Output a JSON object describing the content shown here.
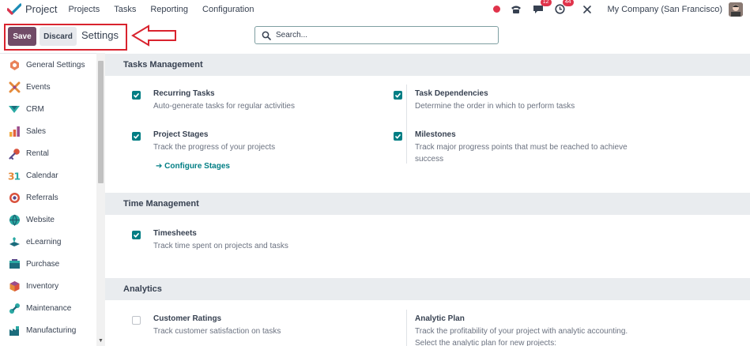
{
  "navbar": {
    "app_name": "Project",
    "menu": [
      "Projects",
      "Tasks",
      "Reporting",
      "Configuration"
    ],
    "messages_count": "12",
    "activities_count": "44",
    "company": "My Company (San Francisco)"
  },
  "control_panel": {
    "save_label": "Save",
    "discard_label": "Discard",
    "title": "Settings",
    "search_placeholder": "Search..."
  },
  "sidebar": {
    "items": [
      {
        "label": "General Settings",
        "icon": "general-settings-icon"
      },
      {
        "label": "Events",
        "icon": "events-icon"
      },
      {
        "label": "CRM",
        "icon": "crm-icon"
      },
      {
        "label": "Sales",
        "icon": "sales-icon"
      },
      {
        "label": "Rental",
        "icon": "rental-icon"
      },
      {
        "label": "Calendar",
        "icon": "calendar-icon"
      },
      {
        "label": "Referrals",
        "icon": "referrals-icon"
      },
      {
        "label": "Website",
        "icon": "website-icon"
      },
      {
        "label": "eLearning",
        "icon": "elearning-icon"
      },
      {
        "label": "Purchase",
        "icon": "purchase-icon"
      },
      {
        "label": "Inventory",
        "icon": "inventory-icon"
      },
      {
        "label": "Maintenance",
        "icon": "maintenance-icon"
      },
      {
        "label": "Manufacturing",
        "icon": "manufacturing-icon"
      }
    ]
  },
  "sections": {
    "tasks": {
      "title": "Tasks Management",
      "recurring": {
        "title": "Recurring Tasks",
        "desc": "Auto-generate tasks for regular activities",
        "checked": true
      },
      "dependencies": {
        "title": "Task Dependencies",
        "desc": "Determine the order in which to perform tasks",
        "checked": true
      },
      "stages": {
        "title": "Project Stages",
        "desc": "Track the progress of your projects",
        "link": "Configure Stages",
        "checked": true
      },
      "milestones": {
        "title": "Milestones",
        "desc": "Track major progress points that must be reached to achieve success",
        "checked": true
      }
    },
    "time": {
      "title": "Time Management",
      "timesheets": {
        "title": "Timesheets",
        "desc": "Track time spent on projects and tasks",
        "checked": true
      }
    },
    "analytics": {
      "title": "Analytics",
      "ratings": {
        "title": "Customer Ratings",
        "desc": "Track customer satisfaction on tasks",
        "checked": false
      },
      "plan": {
        "title": "Analytic Plan",
        "desc": "Track the profitability of your project with analytic accounting.",
        "desc2": "Select the analytic plan for new projects:"
      }
    }
  },
  "colors": {
    "brand": "#714b67",
    "accent": "#017e84",
    "highlight": "#d9232e"
  }
}
